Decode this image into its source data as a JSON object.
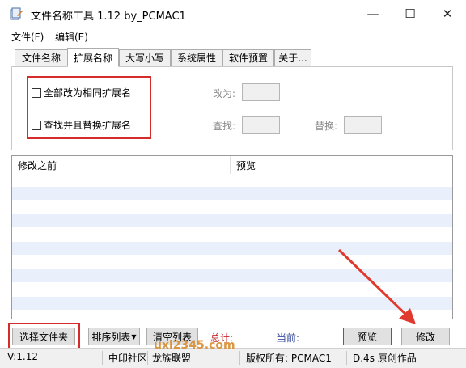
{
  "window": {
    "title": "文件名称工具 1.12   by_PCMAC1",
    "minimize_glyph": "—",
    "maximize_glyph": "☐",
    "close_glyph": "✕"
  },
  "menu": [
    "文件(F)",
    "编辑(E)"
  ],
  "tabs": [
    "文件名称",
    "扩展名称",
    "大写小写",
    "系统属性",
    "软件预置",
    "关于..."
  ],
  "options": {
    "change_all_label": "全部改为相同扩展名",
    "find_replace_label": "查找并且替换扩展名",
    "change_to_label": "改为:",
    "change_to_value": "",
    "find_label": "查找:",
    "find_value": "",
    "replace_label": "替换:",
    "replace_value": ""
  },
  "list": {
    "columns": [
      "修改之前",
      "预览"
    ],
    "rows": []
  },
  "buttons": {
    "select_folder": "选择文件夹",
    "sort_list": "排序列表",
    "clear_list": "清空列表",
    "preview": "预览",
    "modify": "修改"
  },
  "status_line": {
    "total_label": "总计:",
    "current_label": "当前:"
  },
  "statusbar": {
    "version": "V:1.12",
    "community": "中印社区",
    "alliance": "龙族联盟",
    "copyright": "版权所有: PCMAC1",
    "work": "D.4s 原创作品"
  },
  "watermark": "uxl2345.com",
  "colors": {
    "highlight_red": "#d52b2b",
    "status_red": "#c8282d",
    "status_blue": "#3c50a0",
    "button_focus": "#0078d7",
    "row_stripe": "#eaf0fb"
  }
}
